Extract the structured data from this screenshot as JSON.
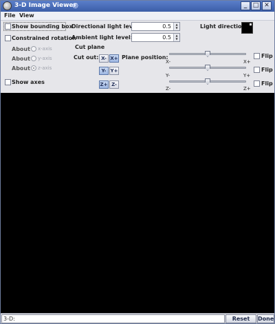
{
  "window": {
    "title": "3-D Image Viewer"
  },
  "menu": {
    "file": "File",
    "view": "View"
  },
  "options": {
    "show_bounding_box": "Show bounding box",
    "constrained_rotation": "Constrained rotation",
    "about_label": "About",
    "axes": [
      "x-axis",
      "y-axis",
      "z-axis"
    ],
    "selected_axis": "z-axis",
    "show_axes": "Show axes"
  },
  "lighting": {
    "directional_label": "Directional light level:",
    "directional_value": "0.5",
    "ambient_label": "Ambient light level:",
    "ambient_value": "0.5",
    "direction_label": "Light direction:"
  },
  "cut_plane": {
    "title": "Cut plane",
    "cut_out_label": "Cut out:",
    "plane_position_label": "Plane position:",
    "buttons": [
      {
        "minus": "X-",
        "plus": "X+",
        "selected": "X+"
      },
      {
        "minus": "Y-",
        "plus": "Y+",
        "selected": "Y-"
      },
      {
        "minus": "Z+",
        "plus": "Z-",
        "selected": "Z+"
      }
    ],
    "sliders": [
      {
        "min_label": "X-",
        "max_label": "X+",
        "position": 0.5,
        "flip": "Flip"
      },
      {
        "min_label": "Y-",
        "max_label": "Y+",
        "position": 0.5,
        "flip": "Flip"
      },
      {
        "min_label": "Z-",
        "max_label": "Z+",
        "position": 0.5,
        "flip": "Flip"
      }
    ]
  },
  "bottom": {
    "prompt": "3-D:",
    "reset_view": "Reset View",
    "done": "Done"
  }
}
